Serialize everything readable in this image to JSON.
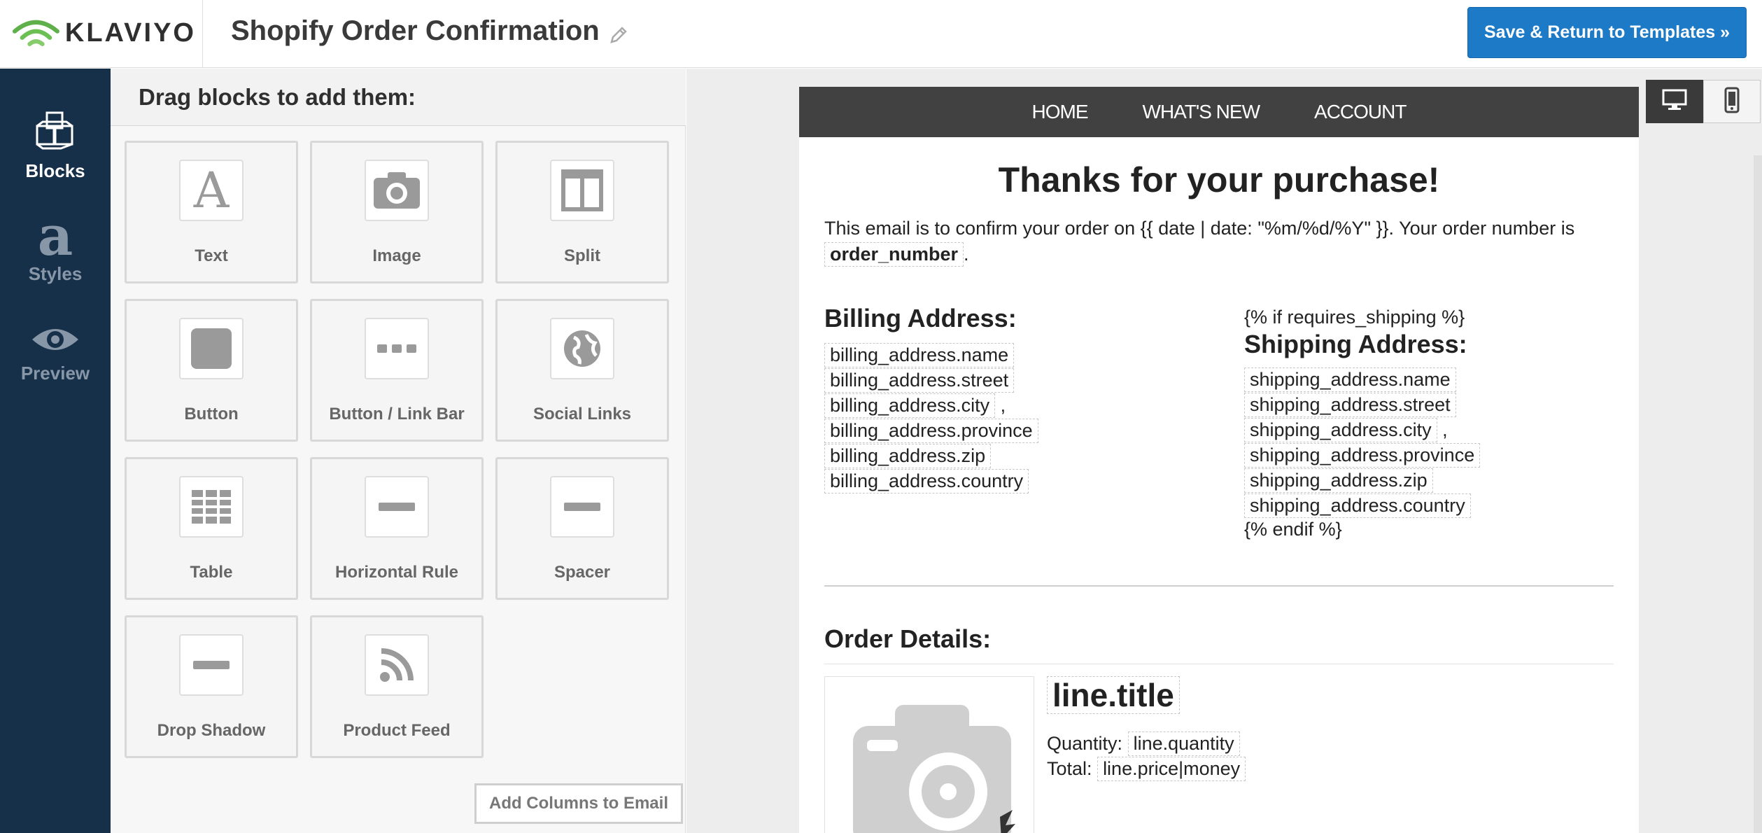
{
  "app": {
    "brand": "KLAVIYO",
    "document_title": "Shopify Order Confirmation",
    "save_button": "Save & Return to Templates »"
  },
  "sidebar": {
    "items": [
      {
        "label": "Blocks",
        "icon": "blocks-icon",
        "active": true
      },
      {
        "label": "Styles",
        "icon": "styles-icon",
        "active": false
      },
      {
        "label": "Preview",
        "icon": "eye-icon",
        "active": false
      }
    ]
  },
  "blocks_panel": {
    "heading": "Drag blocks to add them:",
    "tiles": [
      {
        "label": "Text",
        "icon": "text-icon"
      },
      {
        "label": "Image",
        "icon": "camera-icon"
      },
      {
        "label": "Split",
        "icon": "split-icon"
      },
      {
        "label": "Button",
        "icon": "button-icon"
      },
      {
        "label": "Button / Link Bar",
        "icon": "link-bar-icon"
      },
      {
        "label": "Social Links",
        "icon": "globe-icon"
      },
      {
        "label": "Table",
        "icon": "table-icon"
      },
      {
        "label": "Horizontal Rule",
        "icon": "horizontal-rule-icon"
      },
      {
        "label": "Spacer",
        "icon": "spacer-icon"
      },
      {
        "label": "Drop Shadow",
        "icon": "drop-shadow-icon"
      },
      {
        "label": "Product Feed",
        "icon": "rss-icon"
      }
    ],
    "add_columns_button": "Add Columns to Email"
  },
  "device_toggle": {
    "selected": "desktop",
    "options": [
      "desktop-icon",
      "mobile-icon"
    ]
  },
  "email": {
    "nav": [
      "HOME",
      "WHAT'S NEW",
      "ACCOUNT"
    ],
    "title": "Thanks for your purchase!",
    "intro_prefix": "This email is to confirm your order on {{ date | date: \"%m/%d/%Y\" }}. Your order number is",
    "order_number_var": "order_number",
    "intro_suffix": ".",
    "billing": {
      "heading": "Billing Address:",
      "lines": [
        {
          "var": "billing_address.name",
          "suffix": ""
        },
        {
          "var": "billing_address.street",
          "suffix": ""
        },
        {
          "var": "billing_address.city",
          "suffix": " ,"
        },
        {
          "var": "billing_address.province",
          "suffix": ""
        },
        {
          "var": "billing_address.zip",
          "suffix": ""
        },
        {
          "var": "billing_address.country",
          "suffix": ""
        }
      ]
    },
    "shipping": {
      "if_tag": "{% if requires_shipping %}",
      "heading": "Shipping Address:",
      "lines": [
        {
          "var": "shipping_address.name",
          "suffix": ""
        },
        {
          "var": "shipping_address.street",
          "suffix": ""
        },
        {
          "var": "shipping_address.city",
          "suffix": " ,"
        },
        {
          "var": "shipping_address.province",
          "suffix": ""
        },
        {
          "var": "shipping_address.zip",
          "suffix": ""
        },
        {
          "var": "shipping_address.country",
          "suffix": ""
        }
      ],
      "endif_tag": "{% endif %}"
    },
    "order_details": {
      "heading": "Order Details:",
      "line_title_var": "line.title",
      "quantity_label": "Quantity:",
      "quantity_var": "line.quantity",
      "total_label": "Total:",
      "total_var": "line.price|money"
    }
  },
  "colors": {
    "nav_bg": "#17304a",
    "save_button_bg": "#1d7ac7",
    "email_nav_bg": "#414141",
    "logo_green": "#5fb04a"
  }
}
